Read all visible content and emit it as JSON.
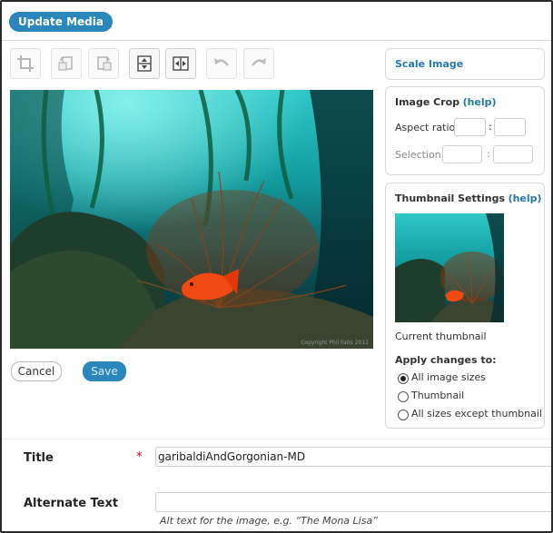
{
  "header": {
    "update_button": "Update Media"
  },
  "toolbar": {
    "buttons": [
      {
        "name": "crop",
        "icon": "crop-icon"
      },
      {
        "name": "rotate-left",
        "icon": "rotate-left-icon"
      },
      {
        "name": "rotate-right",
        "icon": "rotate-right-icon"
      },
      {
        "name": "flip-vertical",
        "icon": "flip-vertical-icon"
      },
      {
        "name": "flip-horizontal",
        "icon": "flip-horizontal-icon"
      },
      {
        "name": "undo",
        "icon": "undo-icon"
      },
      {
        "name": "redo",
        "icon": "redo-icon"
      }
    ]
  },
  "image": {
    "watermark": "Copyright Phil Fatis 2011"
  },
  "actions": {
    "cancel": "Cancel",
    "save": "Save"
  },
  "scale_panel": {
    "title": "Scale Image"
  },
  "crop_panel": {
    "title": "Image Crop",
    "help": "(help)",
    "aspect_label": "Aspect ratio:",
    "selection_label": "Selection:",
    "separator": ":"
  },
  "thumb_panel": {
    "title": "Thumbnail Settings",
    "help": "(help)",
    "current_label": "Current thumbnail",
    "apply_label": "Apply changes to:",
    "options": [
      "All image sizes",
      "Thumbnail",
      "All sizes except thumbnail"
    ],
    "selected_index": 0
  },
  "fields": {
    "title_label": "Title",
    "required_mark": "*",
    "title_value": "garibaldiAndGorgonian-MD",
    "alt_label": "Alternate Text",
    "alt_value": "",
    "alt_help": "Alt text for the image, e.g. “The Mona Lisa”"
  }
}
